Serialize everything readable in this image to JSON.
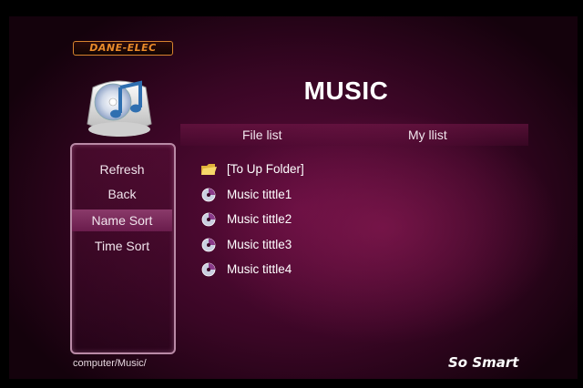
{
  "brand": {
    "logo_text": "DANE-ELEC"
  },
  "header": {
    "title": "MUSIC"
  },
  "tabs": [
    {
      "label": "File list"
    },
    {
      "label": "My llist"
    }
  ],
  "sidebar": {
    "items": [
      {
        "label": "Refresh",
        "selected": false
      },
      {
        "label": "Back",
        "selected": false
      },
      {
        "label": "Name Sort",
        "selected": true
      },
      {
        "label": "Time Sort",
        "selected": false
      }
    ]
  },
  "files": [
    {
      "label": "[To Up Folder]",
      "icon": "folder-icon"
    },
    {
      "label": "Music tittle1",
      "icon": "disc-icon"
    },
    {
      "label": "Music tittle2",
      "icon": "disc-icon"
    },
    {
      "label": "Music tittle3",
      "icon": "disc-icon"
    },
    {
      "label": "Music tittle4",
      "icon": "disc-icon"
    }
  ],
  "footer": {
    "path": "computer/Music/",
    "slogan": "So Smart"
  },
  "colors": {
    "background": "#3a0625",
    "brand_accent": "#e88a2a",
    "selection": "#7a2a5c",
    "sidebar_border": "#b98aa6"
  }
}
